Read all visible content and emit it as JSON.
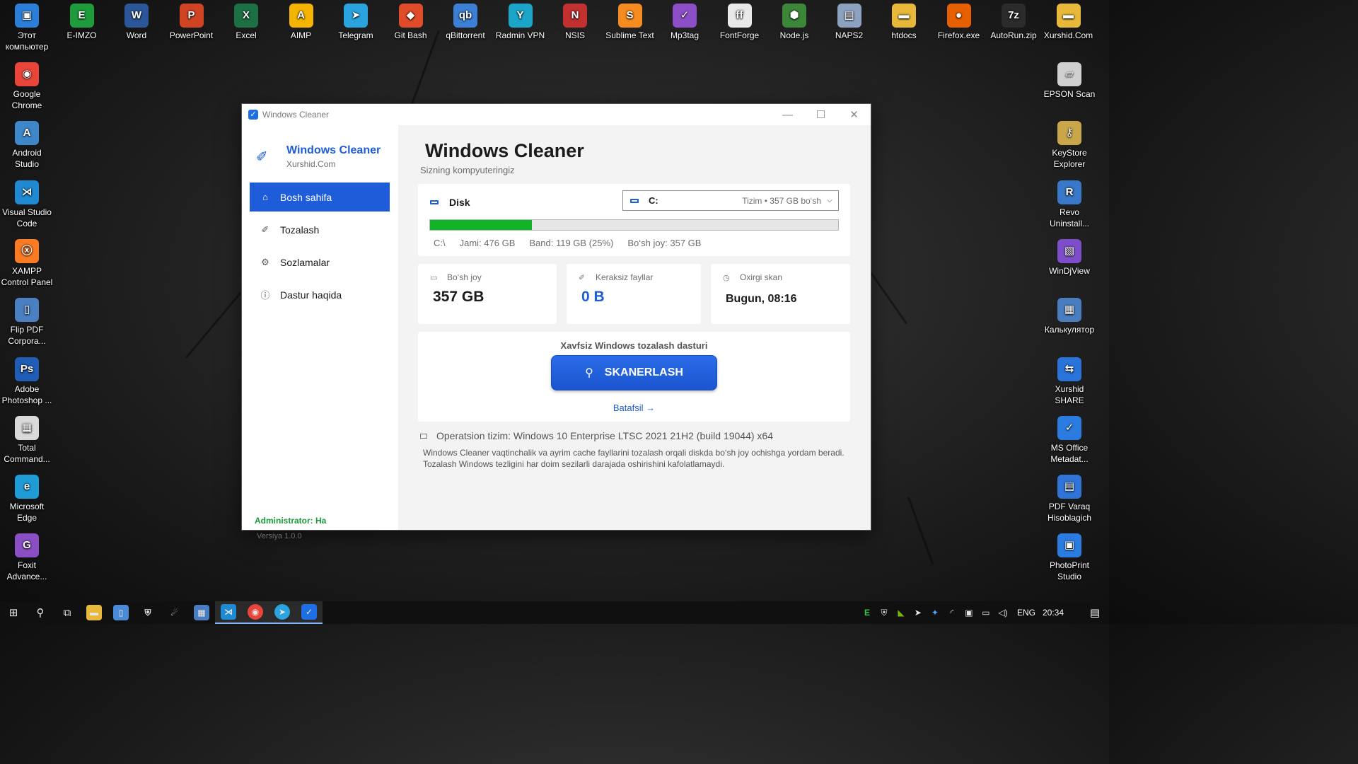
{
  "desktop_top_row": [
    {
      "label": "Этот компьютер",
      "icon": "computer-icon",
      "color": "#2b7fd8",
      "glyph": "▣"
    },
    {
      "label": "E-IMZO",
      "icon": "eimzo-icon",
      "color": "#1e9b3a",
      "glyph": "E"
    },
    {
      "label": "Word",
      "icon": "word-icon",
      "color": "#2b579a",
      "glyph": "W"
    },
    {
      "label": "PowerPoint",
      "icon": "powerpoint-icon",
      "color": "#d04423",
      "glyph": "P"
    },
    {
      "label": "Excel",
      "icon": "excel-icon",
      "color": "#1d7044",
      "glyph": "X"
    },
    {
      "label": "AIMP",
      "icon": "aimp-icon",
      "color": "#f4b400",
      "glyph": "A"
    },
    {
      "label": "Telegram",
      "icon": "telegram-icon",
      "color": "#2aa3df",
      "glyph": "➤"
    },
    {
      "label": "Git Bash",
      "icon": "git-bash-icon",
      "color": "#e04b2a",
      "glyph": "◆"
    },
    {
      "label": "qBittorrent",
      "icon": "qbittorrent-icon",
      "color": "#3b7fd6",
      "glyph": "qb"
    },
    {
      "label": "Radmin VPN",
      "icon": "radmin-vpn-icon",
      "color": "#1ba6c9",
      "glyph": "Y"
    },
    {
      "label": "NSIS",
      "icon": "nsis-icon",
      "color": "#c23030",
      "glyph": "N"
    },
    {
      "label": "Sublime Text",
      "icon": "sublime-text-icon",
      "color": "#f68b1f",
      "glyph": "S"
    },
    {
      "label": "Mp3tag",
      "icon": "mp3tag-icon",
      "color": "#8c4fc7",
      "glyph": "✓"
    },
    {
      "label": "FontForge",
      "icon": "fontforge-icon",
      "color": "#e9e9e9",
      "glyph": "ff"
    },
    {
      "label": "Node.js",
      "icon": "nodejs-icon",
      "color": "#3c873a",
      "glyph": "⬢"
    },
    {
      "label": "NAPS2",
      "icon": "naps2-icon",
      "color": "#8da2c0",
      "glyph": "▤"
    },
    {
      "label": "htdocs",
      "icon": "folder-icon",
      "color": "#e8b83a",
      "glyph": "▬"
    },
    {
      "label": "Firefox.exe",
      "icon": "firefox-icon",
      "color": "#e66000",
      "glyph": "●"
    },
    {
      "label": "AutoRun.zip",
      "icon": "7zip-icon",
      "color": "#2b2b2b",
      "glyph": "7z"
    },
    {
      "label": "Xurshid.Com",
      "icon": "folder-icon",
      "color": "#e8b83a",
      "glyph": "▬"
    }
  ],
  "desktop_left_col": [
    {
      "label": "Google Chrome",
      "icon": "chrome-icon",
      "color": "#e9453a",
      "glyph": "◉"
    },
    {
      "label": "Android Studio",
      "icon": "android-studio-icon",
      "color": "#3e87c9",
      "glyph": "A"
    },
    {
      "label": "Visual Studio Code",
      "icon": "vscode-icon",
      "color": "#1f8ad2",
      "glyph": "⋊"
    },
    {
      "label": "XAMPP Control Panel",
      "icon": "xampp-icon",
      "color": "#fb7a24",
      "glyph": "ⓧ"
    },
    {
      "label": "Flip PDF Corpora...",
      "icon": "flip-pdf-icon",
      "color": "#4a7fc1",
      "glyph": "▯"
    },
    {
      "label": "Adobe Photoshop ...",
      "icon": "photoshop-icon",
      "color": "#1f5db6",
      "glyph": "Ps"
    },
    {
      "label": "Total Command...",
      "icon": "total-commander-icon",
      "color": "#d9d9d9",
      "glyph": "▦"
    },
    {
      "label": "Microsoft Edge",
      "icon": "edge-icon",
      "color": "#1f9bd6",
      "glyph": "e"
    },
    {
      "label": "Foxit Advance...",
      "icon": "foxit-icon",
      "color": "#8a4fc4",
      "glyph": "G"
    }
  ],
  "desktop_right_col": [
    {
      "label": "EPSON Scan",
      "icon": "epson-scan-icon",
      "color": "#d0d0d0",
      "glyph": "▱"
    },
    {
      "label": "KeyStore Explorer",
      "icon": "keystore-explorer-icon",
      "color": "#c9a64a",
      "glyph": "⚷"
    },
    {
      "label": "Revo Uninstall...",
      "icon": "revo-uninstaller-icon",
      "color": "#3a78c9",
      "glyph": "R"
    },
    {
      "label": "WinDjView",
      "icon": "windjview-icon",
      "color": "#7d4ec8",
      "glyph": "▧"
    },
    {
      "label": "Калькулятор",
      "icon": "calculator-icon",
      "color": "#4a7dbf",
      "glyph": "▦"
    },
    {
      "label": "Xurshid SHARE",
      "icon": "xurshid-share-icon",
      "color": "#2a73db",
      "glyph": "⇆"
    },
    {
      "label": "MS Office Metadat...",
      "icon": "ms-office-metadata-icon",
      "color": "#2b7be0",
      "glyph": "✓"
    },
    {
      "label": "PDF Varaq Hisoblagich",
      "icon": "pdf-counter-icon",
      "color": "#2f74d6",
      "glyph": "▤"
    },
    {
      "label": "PhotoPrint Studio",
      "icon": "photoprint-icon",
      "color": "#2b7be0",
      "glyph": "▣"
    }
  ],
  "window": {
    "title": "Windows Cleaner",
    "brand_name": "Windows Cleaner",
    "brand_sub": "Xurshid.Com",
    "nav": [
      {
        "label": "Bosh sahifa",
        "icon": "home-icon",
        "glyph": "⌂"
      },
      {
        "label": "Tozalash",
        "icon": "broom-icon",
        "glyph": "✐"
      },
      {
        "label": "Sozlamalar",
        "icon": "gear-icon",
        "glyph": "⚙"
      },
      {
        "label": "Dastur haqida",
        "icon": "info-icon",
        "glyph": "ⓘ"
      }
    ],
    "admin_text": "Administrator: Ha",
    "version_text": "Versiya 1.0.0",
    "main_title": "Windows Cleaner",
    "main_subtitle": "Sizning kompyuteringiz",
    "disk_label": "Disk",
    "drive_letter": "C:",
    "drive_meta": "Tizim  •  357 GB bo‘sh",
    "usage_fraction": 0.25,
    "disk_path": "C:\\",
    "disk_total": "Jami: 476 GB",
    "disk_used": "Band: 119 GB (25%)",
    "disk_free": "Bo‘sh joy: 357 GB",
    "stats": [
      {
        "label": "Bo‘sh joy",
        "value": "357 GB",
        "icon": "drive-icon",
        "glyph": "▭"
      },
      {
        "label": "Keraksiz fayllar",
        "value": "0 B",
        "icon": "broom-icon",
        "glyph": "✐"
      },
      {
        "label": "Oxirgi skan",
        "value": "Bugun, 08:16",
        "icon": "clock-icon",
        "glyph": "◷"
      }
    ],
    "scan_caption": "Xavfsiz Windows tozalash dasturi",
    "scan_button": "SKANERLASH",
    "more_link": "Batafsil →",
    "os_info": "Operatsion tizim: Windows 10 Enterprise LTSC 2021 21H2 (build 19044) x64",
    "description": "Windows Cleaner vaqtinchalik va ayrim cache fayllarini tozalash orqali diskda bo‘sh joy ochishga yordam beradi. Tozalash Windows tezligini har doim sezilarli darajada oshirishini kafolatlamaydi."
  },
  "taskbar": {
    "language": "ENG",
    "time": "20:34"
  },
  "colors": {
    "accent": "#1e5cd9",
    "usage_fill": "#10b426",
    "admin_green": "#1a9b3c"
  }
}
